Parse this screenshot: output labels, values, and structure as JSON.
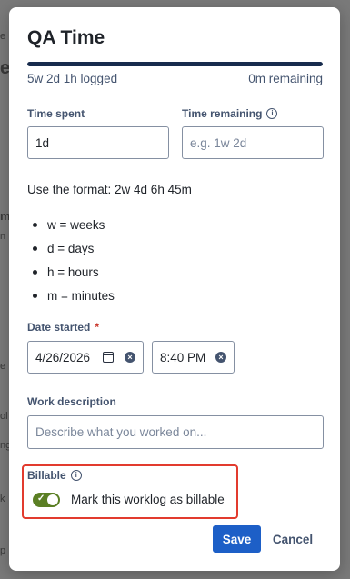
{
  "background_fragments": [
    "e",
    "m",
    "n",
    "e",
    "ol",
    "ng",
    "k",
    "p"
  ],
  "dialog": {
    "title": "QA Time",
    "progress": {
      "fill_fraction": 1.0,
      "logged": "5w 2d 1h logged",
      "remaining": "0m remaining"
    },
    "time_spent": {
      "label": "Time spent",
      "value": "1d"
    },
    "time_remaining": {
      "label": "Time remaining",
      "placeholder": "e.g. 1w 2d"
    },
    "format_hint": "Use the format: 2w 4d 6h 45m",
    "units": [
      "w = weeks",
      "d = days",
      "h = hours",
      "m = minutes"
    ],
    "date_started": {
      "label": "Date started",
      "required_marker": "*",
      "date": "4/26/2026",
      "time": "8:40 PM"
    },
    "work_description": {
      "label": "Work description",
      "placeholder": "Describe what you worked on..."
    },
    "billable": {
      "label": "Billable",
      "toggle_text": "Mark this worklog as billable",
      "checked": true,
      "toggle_color": "#5b7f24"
    },
    "actions": {
      "save": "Save",
      "cancel": "Cancel"
    }
  },
  "colors": {
    "accent": "#1d5fc7",
    "highlight_border": "#e23b2e",
    "progress": "#172b4d"
  },
  "icons": [
    "info-icon",
    "calendar-icon",
    "clear-icon",
    "check-icon"
  ]
}
